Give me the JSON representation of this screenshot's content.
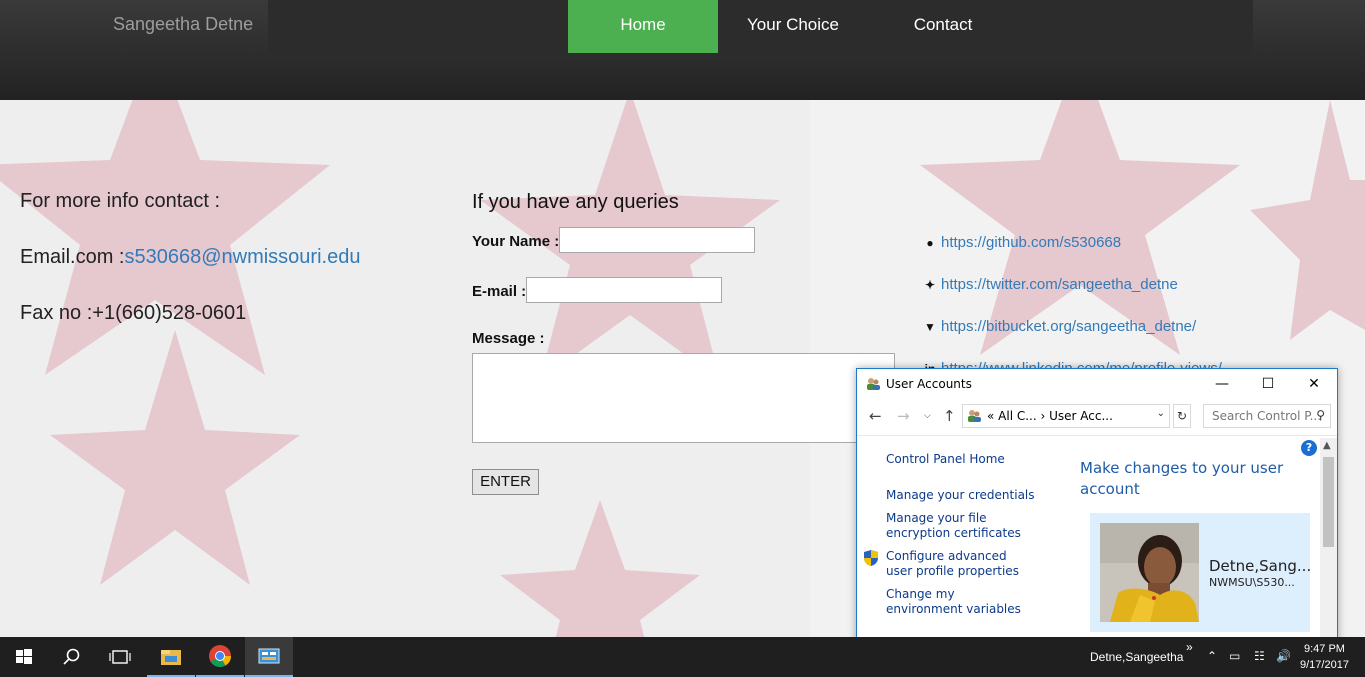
{
  "nav": {
    "brand": "Sangeetha Detne",
    "items": [
      {
        "label": "Home",
        "active": true
      },
      {
        "label": "Your Choice",
        "active": false
      },
      {
        "label": "Contact",
        "active": false
      }
    ],
    "accent_color": "#4caf50"
  },
  "contact": {
    "heading": "For more info contact :",
    "email_label": "Email.com :",
    "email_value": "s530668@nwmissouri.edu",
    "fax_label": "Fax no :",
    "fax_value": "+1(660)528-0601"
  },
  "form": {
    "heading": "If you have any queries",
    "name_label": "Your Name :",
    "name_value": "",
    "email_label": "E-mail :",
    "email_value": "",
    "message_label": "Message :",
    "message_value": "",
    "submit_label": "ENTER"
  },
  "social_links": [
    {
      "icon": "github-icon",
      "url": "https://github.com/s530668"
    },
    {
      "icon": "twitter-icon",
      "url": "https://twitter.com/sangeetha_detne"
    },
    {
      "icon": "bitbucket-icon",
      "url": "https://bitbucket.org/sangeetha_detne/"
    },
    {
      "icon": "linkedin-icon",
      "url": "https://www.linkedin.com/me/profile-views/"
    }
  ],
  "user_accounts_window": {
    "title": "User Accounts",
    "address_crumbs": "«  All C...  ›  User Acc...",
    "search_placeholder": "Search Control P...",
    "sidebar_links": [
      "Control Panel Home",
      "Manage your credentials",
      "Manage your file encryption certificates",
      "Configure advanced user profile properties",
      "Change my environment variables"
    ],
    "main_heading": "Make changes to your user account",
    "account_name": "Detne,Sang...",
    "account_domain": "NWMSU\\S530...",
    "link_color": "#0c3a8a",
    "heading_color": "#1e5ba8"
  },
  "taskbar": {
    "user_name": "Detne,Sangeetha",
    "time": "9:47 PM",
    "date": "9/17/2017",
    "apps": [
      "start-icon",
      "search-icon",
      "task-view-icon",
      "file-explorer-icon",
      "chrome-icon",
      "control-panel-icon"
    ]
  }
}
